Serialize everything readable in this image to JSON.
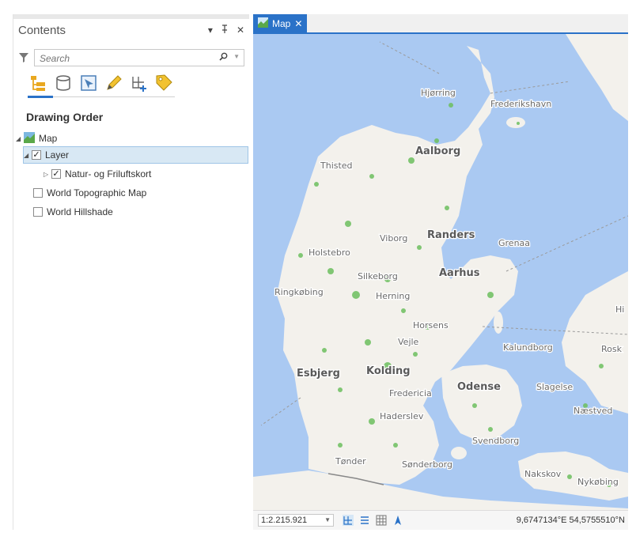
{
  "contents_pane": {
    "title": "Contents",
    "controls": {
      "menu": "▾",
      "pin": "ᵠ",
      "close": "✕"
    },
    "search": {
      "placeholder": "Search",
      "value": ""
    },
    "toolbar": [
      "list-by-drawing-order-icon",
      "list-by-data-source-icon",
      "list-by-selection-icon",
      "list-by-editing-icon",
      "list-by-snapping-icon",
      "list-by-labeling-icon"
    ],
    "section_title": "Drawing Order",
    "tree": {
      "map": {
        "label": "Map"
      },
      "layer": {
        "label": "Layer",
        "checked": true
      },
      "sublayer": {
        "label": "Natur- og Friluftskort",
        "checked": true
      },
      "topo": {
        "label": "World Topographic Map",
        "checked": false
      },
      "hillshade": {
        "label": "World Hillshade",
        "checked": false
      }
    }
  },
  "map_pane": {
    "tab": {
      "label": "Map",
      "close": "✕"
    },
    "labels": {
      "hjorring": "Hjørring",
      "frederikshavn": "Frederikshavn",
      "aalborg": "Aalborg",
      "thisted": "Thisted",
      "viborg": "Viborg",
      "randers": "Randers",
      "grenaa": "Grenaa",
      "holstebro": "Holstebro",
      "silkeborg": "Silkeborg",
      "aarhus": "Aarhus",
      "ringkobing": "Ringkøbing",
      "herning": "Herning",
      "horsens": "Horsens",
      "vejle": "Vejle",
      "kalundborg": "Kalundborg",
      "rosk": "Rosk",
      "hi": "Hi",
      "esbjerg": "Esbjerg",
      "kolding": "Kolding",
      "odense": "Odense",
      "slagelse": "Slagelse",
      "fredericia": "Fredericia",
      "naestved": "Næstved",
      "haderslev": "Haderslev",
      "svendborg": "Svendborg",
      "tonder": "Tønder",
      "sonderborg": "Sønderborg",
      "nakskov": "Nakskov",
      "nykobing": "Nykøbing"
    },
    "status": {
      "scale": "1:2.215.921",
      "coordinates": "9,6747134°E 54,5755510°N"
    },
    "colors": {
      "water": "#aac9f2",
      "land": "#f3f1ec",
      "green": "#6cbf5f",
      "accent": "#2a72c8"
    }
  }
}
